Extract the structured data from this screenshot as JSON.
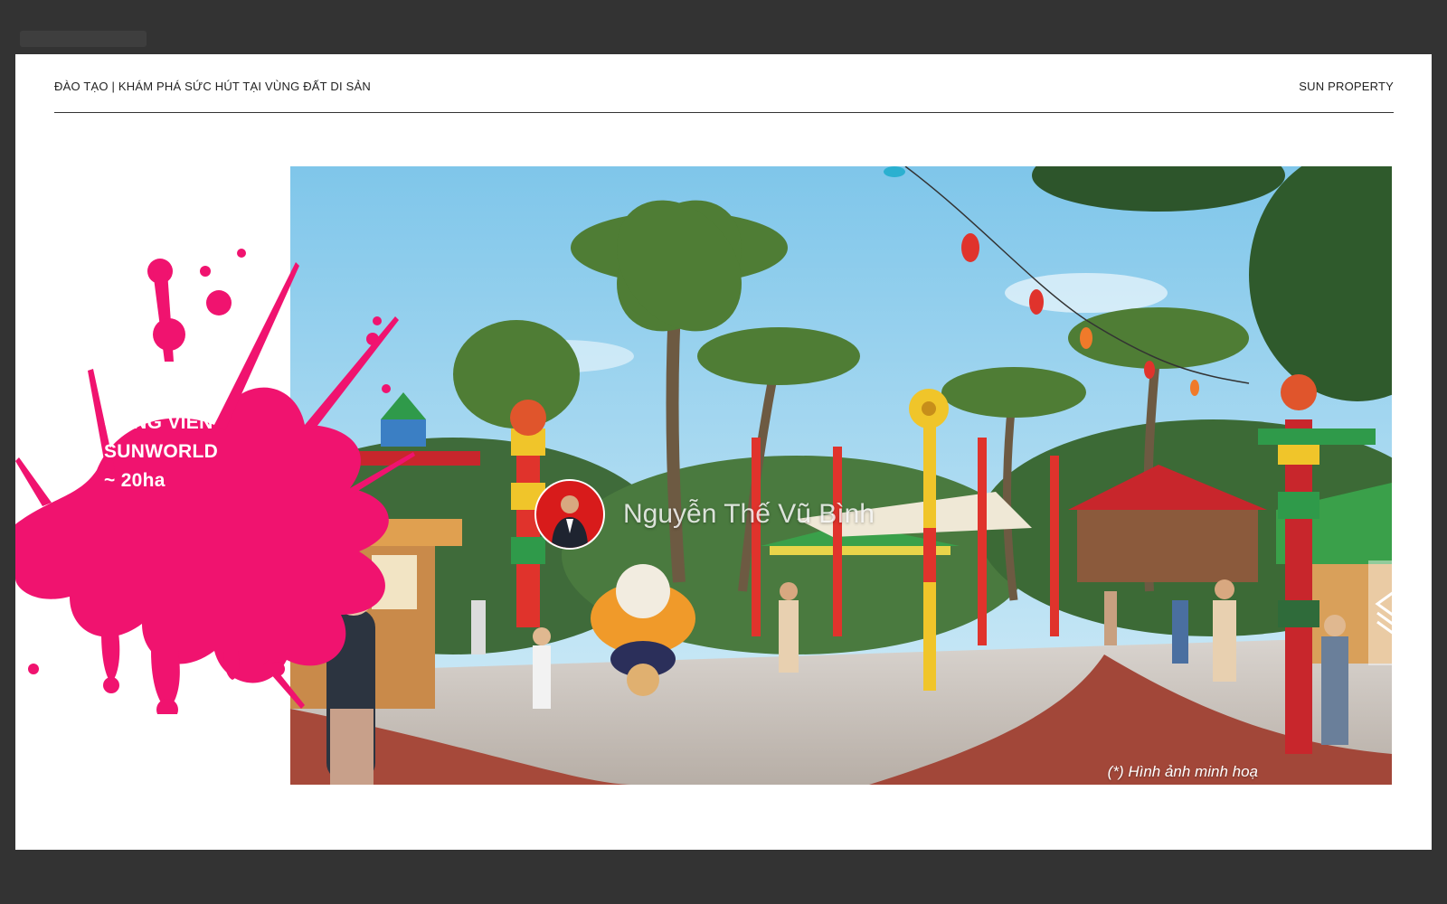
{
  "header": {
    "left_label": "ĐÀO TẠO |  KHÁM PHÁ SỨC HÚT TẠI VÙNG ĐẤT DI SẢN",
    "right_label": "SUN PROPERTY"
  },
  "splash": {
    "line1": "CÔNG VIÊN",
    "line2": "SUNWORLD",
    "line3": "~ 20ha",
    "color": "#f0136f"
  },
  "photo": {
    "caption": "(*) Hình ảnh minh hoạ"
  },
  "watermark": {
    "name": "Nguyễn Thế Vũ Bình",
    "avatar_color": "#d81b1b"
  },
  "icons": {
    "layers": "layers-icon",
    "logo": "logo-icon"
  }
}
